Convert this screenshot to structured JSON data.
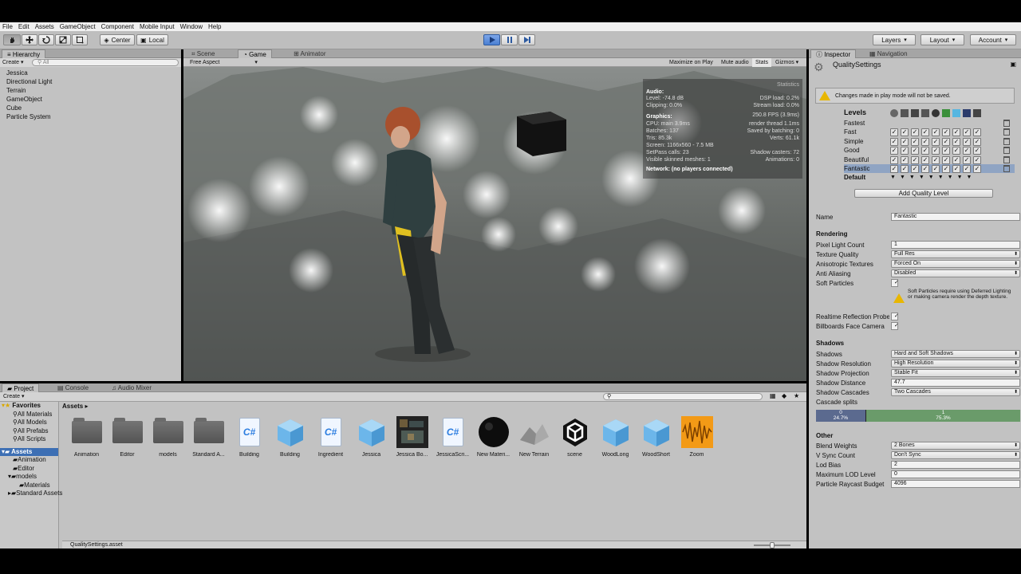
{
  "menu": [
    "File",
    "Edit",
    "Assets",
    "GameObject",
    "Component",
    "Mobile Input",
    "Window",
    "Help"
  ],
  "toolbar": {
    "center_label": "Center",
    "local_label": "Local",
    "layers_label": "Layers",
    "layout_label": "Layout",
    "account_label": "Account"
  },
  "hierarchy": {
    "tab": "Hierarchy",
    "create_label": "Create",
    "search_placeholder": "All",
    "items": [
      "Jessica",
      "Directional Light",
      "Terrain",
      "GameObject",
      "Cube",
      "Particle System"
    ]
  },
  "game": {
    "tabs": [
      "Scene",
      "Game",
      "Animator"
    ],
    "aspect": "Free Aspect",
    "buttons": [
      "Maximize on Play",
      "Mute audio",
      "Stats",
      "Gizmos"
    ],
    "stats": {
      "title": "Statistics",
      "audio_label": "Audio:",
      "audio_rows": [
        [
          "Level: -74.8 dB",
          "DSP load: 0.2%"
        ],
        [
          "Clipping: 0.0%",
          "Stream load: 0.0%"
        ]
      ],
      "graphics_label": "Graphics:",
      "fps": "250.8 FPS (3.9ms)",
      "graphics_rows": [
        [
          "CPU: main 3.9ms",
          "render thread 1.1ms"
        ],
        [
          "Batches: 137",
          "Saved by batching: 0"
        ],
        [
          "Tris: 85.3k",
          "Verts: 61.1k"
        ],
        [
          "Screen: 1166x560 - 7.5 MB",
          ""
        ],
        [
          "SetPass calls: 23",
          "Shadow casters: 72"
        ],
        [
          "Visible skinned meshes: 1",
          "Animations: 0"
        ]
      ],
      "network": "Network: (no players connected)"
    }
  },
  "inspector": {
    "tabs": [
      "Inspector",
      "Navigation"
    ],
    "title": "QualitySettings",
    "warning": "Changes made in play mode will not be saved.",
    "levels_label": "Levels",
    "levels": [
      "Fastest",
      "Fast",
      "Simple",
      "Good",
      "Beautiful",
      "Fantastic"
    ],
    "default_label": "Default",
    "add_level": "Add Quality Level",
    "name_label": "Name",
    "name_value": "Fantastic",
    "rendering_label": "Rendering",
    "rendering": [
      {
        "label": "Pixel Light Count",
        "value": "1"
      },
      {
        "label": "Texture Quality",
        "value": "Full Res"
      },
      {
        "label": "Anisotropic Textures",
        "value": "Forced On"
      },
      {
        "label": "Anti Aliasing",
        "value": "Disabled"
      },
      {
        "label": "Soft Particles",
        "value": "✓"
      }
    ],
    "soft_info": "Soft Particles require using Deferred Lighting or making camera render the depth texture.",
    "realtime_label": "Realtime Reflection Probes",
    "billboards_label": "Billboards Face Camera",
    "shadows_label": "Shadows",
    "shadows": [
      {
        "label": "Shadows",
        "value": "Hard and Soft Shadows"
      },
      {
        "label": "Shadow Resolution",
        "value": "High Resolution"
      },
      {
        "label": "Shadow Projection",
        "value": "Stable Fit"
      },
      {
        "label": "Shadow Distance",
        "value": "47.7"
      },
      {
        "label": "Shadow Cascades",
        "value": "Two Cascades"
      }
    ],
    "cascade_label": "Cascade splits",
    "cascade": {
      "split0_index": "0",
      "split0": "24.7%",
      "split1_index": "1",
      "split1": "75.3%",
      "fraction0": 0.247
    },
    "other_label": "Other",
    "other": [
      {
        "label": "Blend Weights",
        "value": "2 Bones"
      },
      {
        "label": "V Sync Count",
        "value": "Don't Sync"
      },
      {
        "label": "Lod Bias",
        "value": "2"
      },
      {
        "label": "Maximum LOD Level",
        "value": "0"
      },
      {
        "label": "Particle Raycast Budget",
        "value": "4096"
      }
    ]
  },
  "project": {
    "tabs": [
      "Project",
      "Console",
      "Audio Mixer"
    ],
    "create_label": "Create",
    "favorites_label": "Favorites",
    "favorites": [
      "All Materials",
      "All Models",
      "All Prefabs",
      "All Scripts"
    ],
    "assets_label": "Assets",
    "tree": [
      "Animation",
      "Editor",
      "models",
      "Materials",
      "Standard Assets"
    ],
    "breadcrumb": "Assets",
    "items": [
      {
        "label": "Animation",
        "type": "folder"
      },
      {
        "label": "Editor",
        "type": "folder"
      },
      {
        "label": "models",
        "type": "folder"
      },
      {
        "label": "Standard A...",
        "type": "folder"
      },
      {
        "label": "Building",
        "type": "script"
      },
      {
        "label": "Building",
        "type": "prefab"
      },
      {
        "label": "Ingredient",
        "type": "script"
      },
      {
        "label": "Jessica",
        "type": "prefab"
      },
      {
        "label": "Jessica Bo...",
        "type": "texture"
      },
      {
        "label": "JessicaScri...",
        "type": "script"
      },
      {
        "label": "New Materi...",
        "type": "material"
      },
      {
        "label": "New Terrain",
        "type": "terrain"
      },
      {
        "label": "scene",
        "type": "unity"
      },
      {
        "label": "WoodLong",
        "type": "prefab"
      },
      {
        "label": "WoodShort",
        "type": "prefab"
      },
      {
        "label": "Zoom",
        "type": "audio"
      }
    ],
    "status": "QualitySettings.asset"
  },
  "colors": {
    "accent": "#3d6fb4",
    "warning": "#e8b600",
    "cascade": "#6a9b6a"
  }
}
